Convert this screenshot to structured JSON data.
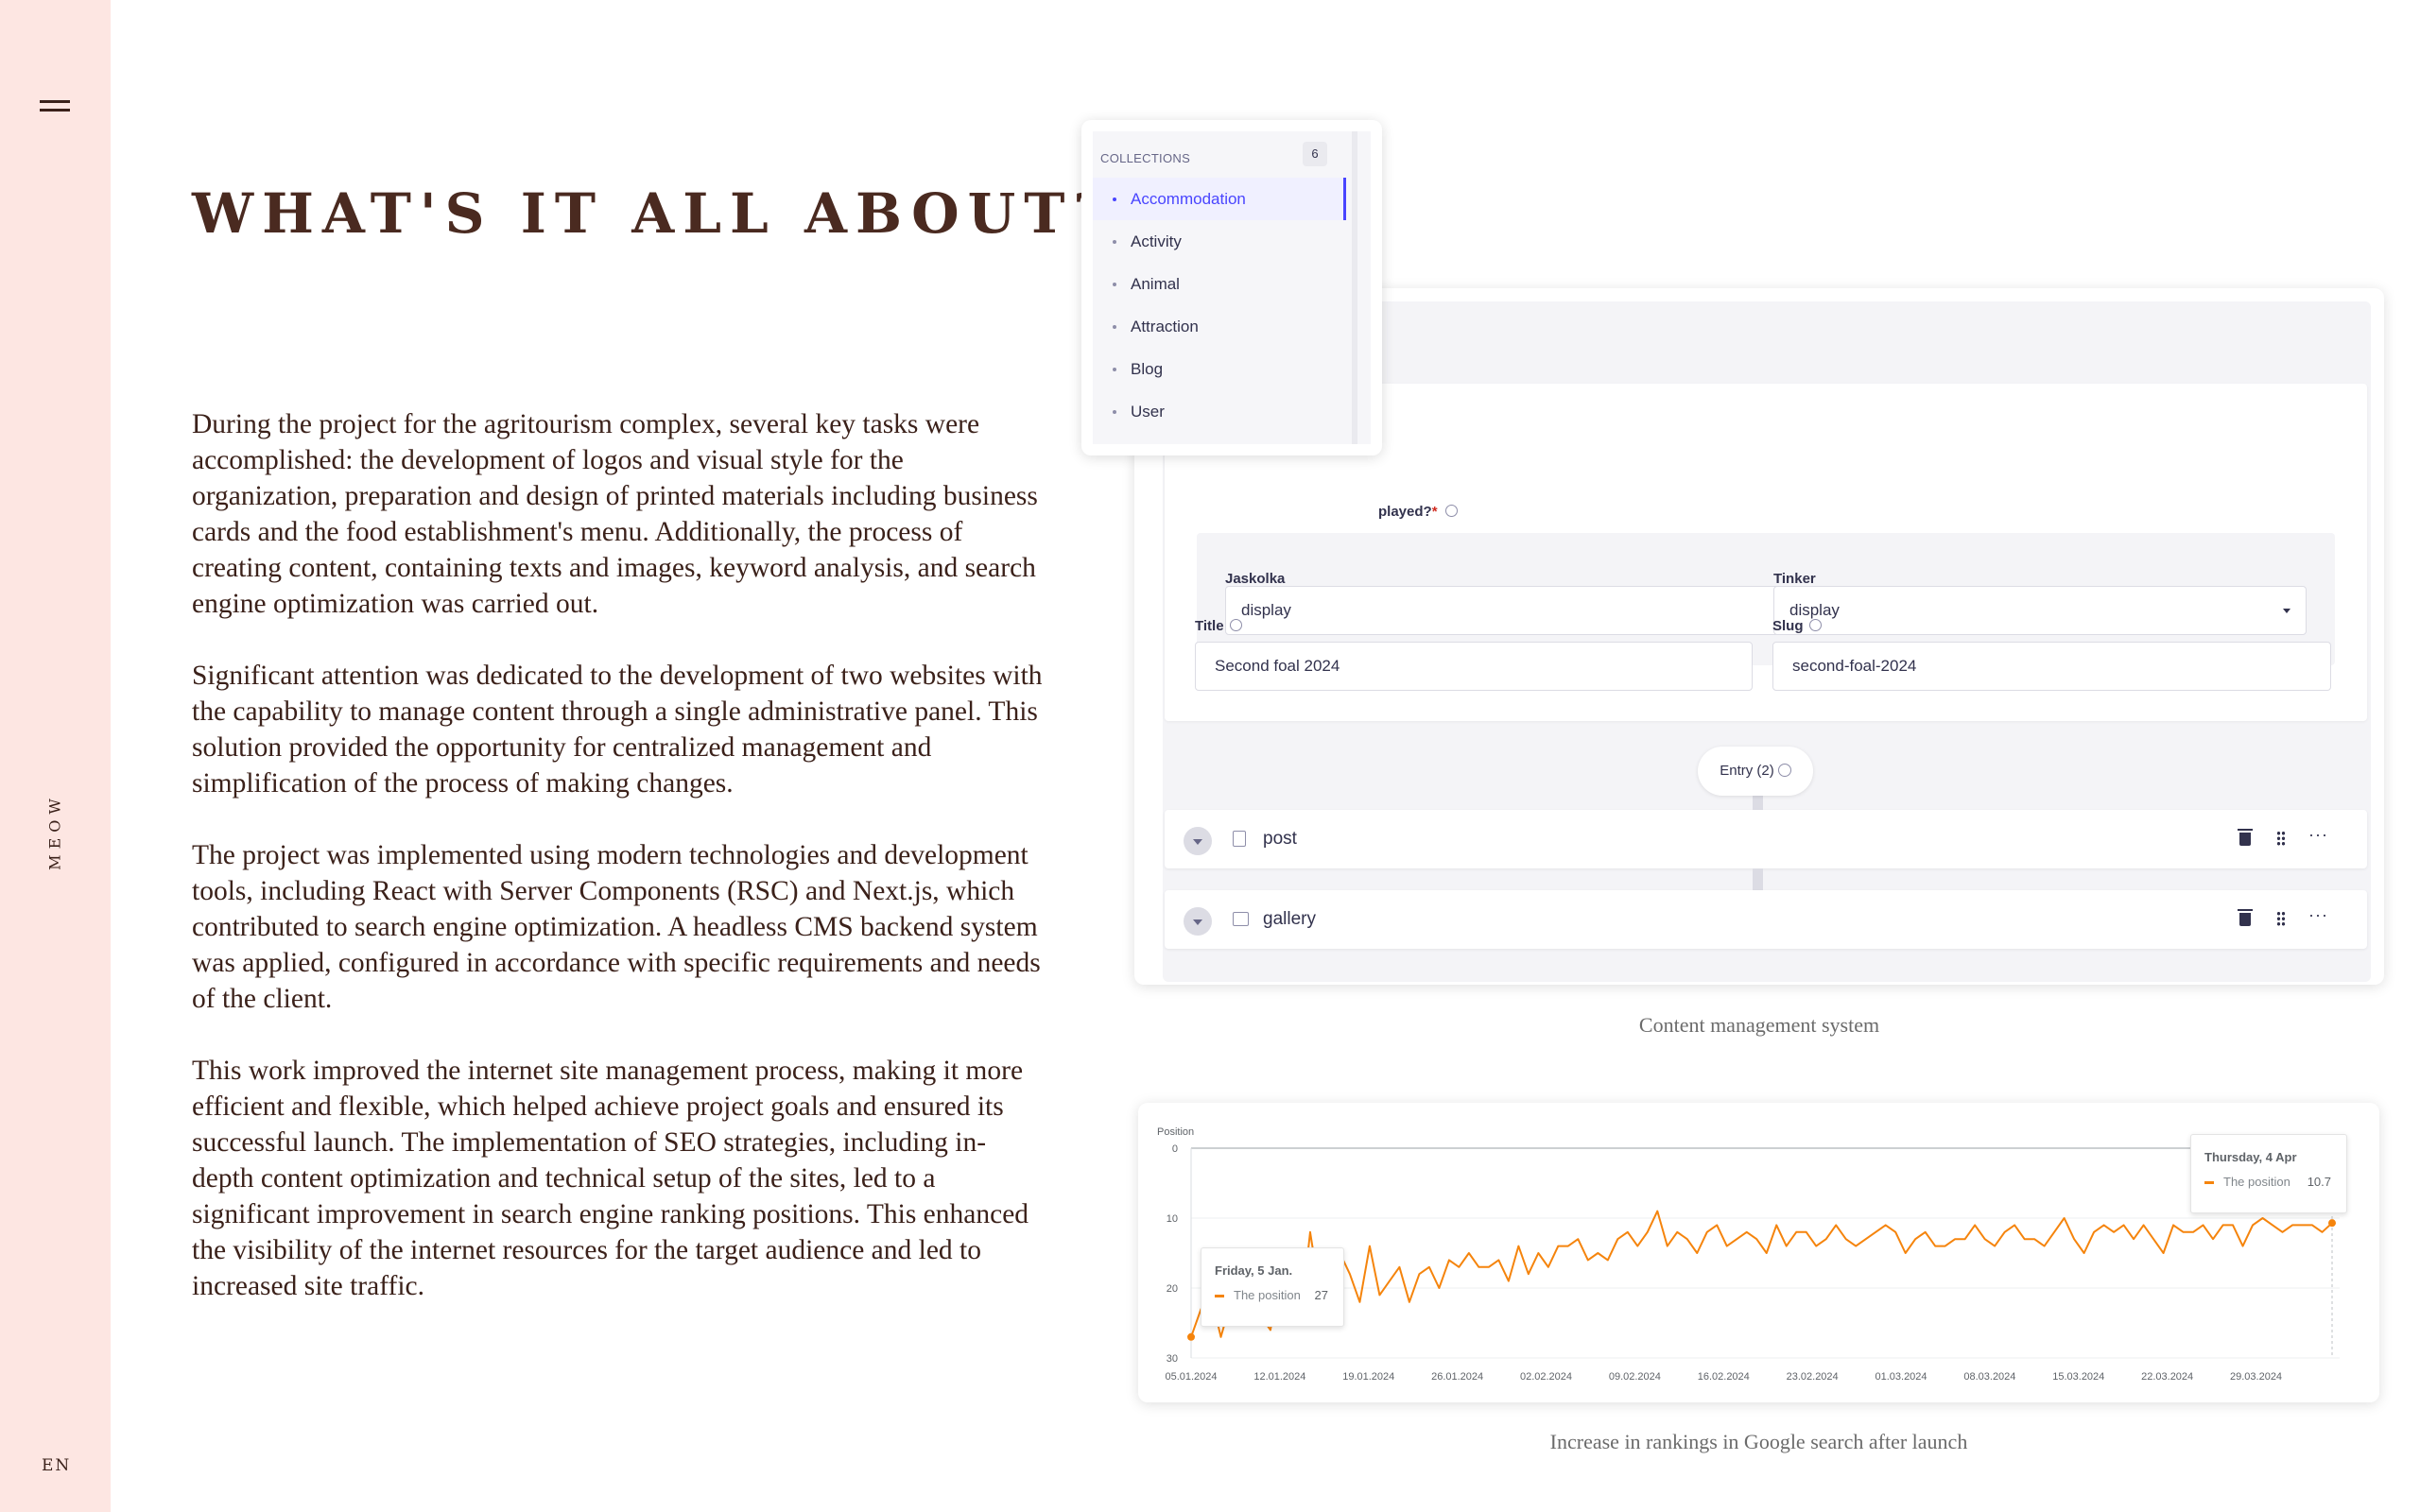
{
  "rail": {
    "brand": "MEOW",
    "language": "EN"
  },
  "heading": "WHAT'S IT ALL ABOUT?",
  "paragraphs": [
    "During the project for the agritourism complex, several key tasks were accomplished: the development of logos and visual style for the organization, preparation and design of printed materials including business cards and the food establishment's menu. Additionally, the process of creating content, containing texts and images, keyword analysis, and search engine optimization was carried out.",
    "Significant attention was dedicated to the development of two websites with the capability to manage content through a single administrative panel. This solution provided the opportunity for centralized management and simplification of the process of making changes.",
    "The project was implemented using modern technologies and development tools, including React with Server Components (RSC) and Next.js, which contributed to search engine optimization. A headless CMS backend system was applied, configured in accordance with specific requirements and needs of the client.",
    "This work improved the internet site management process, making it more efficient and flexible, which helped achieve project goals and ensured its successful launch. The implementation of SEO strategies, including in-depth content optimization and technical setup of the sites, led to a significant improvement in search engine ranking positions. This enhanced the visibility of the internet resources for the target audience and led to increased site traffic."
  ],
  "cms": {
    "question_label": "played?",
    "question_required": "*",
    "jaskolka_label": "Jaskolka",
    "jaskolka_value": "display",
    "tinker_label": "Tinker",
    "tinker_value": "display",
    "title_label": "Title",
    "title_value": "Second foal 2024",
    "slug_label": "Slug",
    "slug_value": "second-foal-2024",
    "entry_label": "Entry (2)",
    "components": [
      "post",
      "gallery"
    ],
    "more_glyph": "···"
  },
  "collections": {
    "header": "COLLECTIONS",
    "count": "6",
    "items": [
      "Accommodation",
      "Activity",
      "Animal",
      "Attraction",
      "Blog",
      "User"
    ],
    "active": "Accommodation"
  },
  "captions": {
    "cms": "Content management system",
    "chart": "Increase in rankings in Google search after launch"
  },
  "chart_data": {
    "type": "line",
    "ylabel": "Position",
    "y_reversed": true,
    "ylim": [
      0,
      30
    ],
    "yticks": [
      0,
      10,
      20,
      30
    ],
    "xtick_labels": [
      "05.01.2024",
      "12.01.2024",
      "19.01.2024",
      "26.01.2024",
      "02.02.2024",
      "09.02.2024",
      "16.02.2024",
      "23.02.2024",
      "01.03.2024",
      "08.03.2024",
      "15.03.2024",
      "22.03.2024",
      "29.03.2024"
    ],
    "x_start": "05.01.2024",
    "x_end": "04.04.2024",
    "line_color": "#f5840c",
    "series": [
      {
        "name": "The position",
        "values": [
          27,
          23,
          21,
          27,
          22,
          21,
          19,
          24,
          26,
          17,
          20,
          25,
          12,
          21,
          24,
          15,
          18,
          22,
          14,
          21,
          19,
          17,
          22,
          18,
          17,
          20,
          16,
          17,
          15,
          17,
          17,
          16,
          19,
          14,
          18,
          15,
          17,
          14,
          14,
          13,
          16,
          15,
          16,
          13,
          12,
          14,
          12,
          9,
          14,
          12,
          13,
          15,
          12,
          11,
          14,
          13,
          12,
          13,
          15,
          11,
          14,
          12,
          12,
          14,
          13,
          11,
          13,
          14,
          13,
          12,
          11,
          12,
          15,
          13,
          12,
          14,
          14,
          13,
          13,
          11,
          13,
          14,
          12,
          11,
          13,
          13,
          14,
          12,
          10,
          13,
          15,
          12,
          11,
          12,
          11,
          13,
          11,
          13,
          15,
          11,
          12,
          12,
          11,
          13,
          11,
          11,
          14,
          11,
          10,
          11,
          12,
          11,
          11,
          11,
          12,
          10.7
        ]
      }
    ],
    "tooltips": [
      {
        "date": "Friday, 5 Jan.",
        "label": "The position",
        "value": "27"
      },
      {
        "date": "Thursday, 4 Apr",
        "label": "The position",
        "value": "10.7"
      }
    ]
  }
}
